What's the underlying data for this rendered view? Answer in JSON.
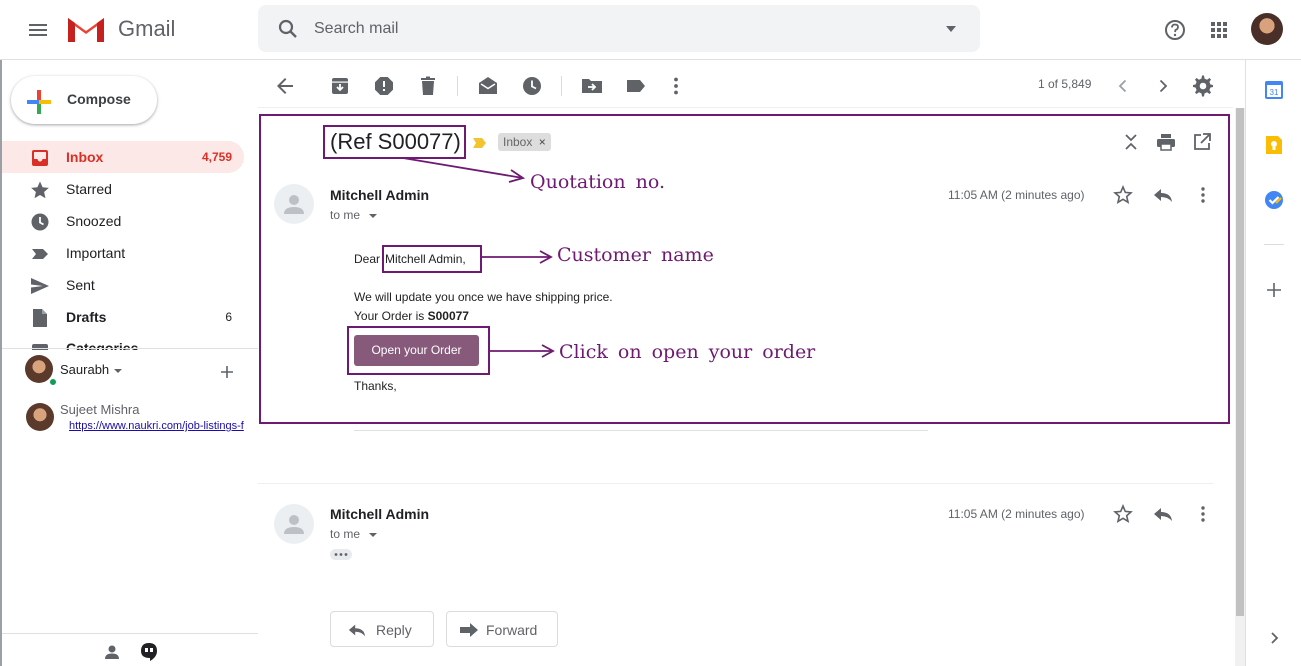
{
  "header": {
    "app_name": "Gmail",
    "search_placeholder": "Search mail"
  },
  "sidebar": {
    "compose_label": "Compose",
    "items": [
      {
        "label": "Inbox",
        "count": "4,759",
        "icon": "inbox-icon",
        "active": true
      },
      {
        "label": "Starred",
        "count": "",
        "icon": "star-icon"
      },
      {
        "label": "Snoozed",
        "count": "",
        "icon": "clock-icon"
      },
      {
        "label": "Important",
        "count": "",
        "icon": "important-icon"
      },
      {
        "label": "Sent",
        "count": "",
        "icon": "send-icon"
      },
      {
        "label": "Drafts",
        "count": "6",
        "icon": "draft-icon",
        "bold": true
      },
      {
        "label": "Categories",
        "count": "",
        "icon": "label-icon"
      }
    ],
    "hangouts": {
      "user_name": "Saurabh",
      "contact_name": "Sujeet Mishra",
      "contact_message": "https://www.naukri.com/job-listings-f"
    }
  },
  "toolbar": {
    "page_count": "1 of 5,849"
  },
  "thread": {
    "subject": "(Ref S00077)",
    "label": "Inbox",
    "messages": [
      {
        "sender": "Mitchell Admin",
        "to": "to me",
        "time": "11:05 AM (2 minutes ago)",
        "greeting_prefix": "Dear",
        "customer_name": "Mitchell Admin,",
        "line1": "We will update you once we have shipping price.",
        "order_prefix": "Your Order is",
        "order_no": "S00077",
        "button_label": "Open your Order",
        "closing": "Thanks,"
      },
      {
        "sender": "Mitchell Admin",
        "to": "to me",
        "time": "11:05 AM (2 minutes ago)"
      }
    ],
    "reply_label": "Reply",
    "forward_label": "Forward"
  },
  "annotations": {
    "quotation": "Quotation no.",
    "customer": "Customer name",
    "open_order": "Click on open your order",
    "color": "#6f1a72"
  },
  "colors": {
    "accent_red": "#d93025",
    "odoo_purple": "#875a7b"
  }
}
